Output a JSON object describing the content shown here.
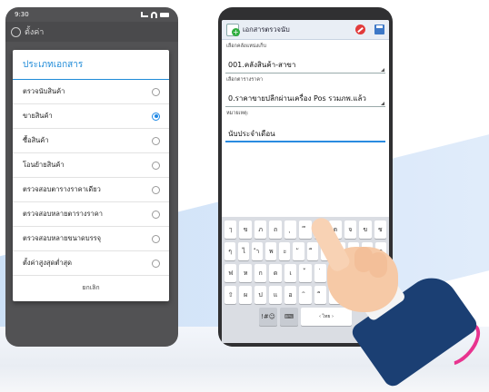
{
  "left_phone": {
    "status_time": "9:30",
    "appbar_title": "ตั้งค่า",
    "dialog": {
      "title": "ประเภทเอกสาร",
      "options": [
        {
          "label": "ตรวจนับสินค้า",
          "selected": false
        },
        {
          "label": "ขายสินค้า",
          "selected": true
        },
        {
          "label": "ซื้อสินค้า",
          "selected": false
        },
        {
          "label": "โอนย้ายสินค้า",
          "selected": false
        },
        {
          "label": "ตรวจสอบตารางราคาเดียว",
          "selected": false
        },
        {
          "label": "ตรวจสอบหลายตารางราคา",
          "selected": false
        },
        {
          "label": "ตรวจสอบหลายขนาดบรรจุ",
          "selected": false
        },
        {
          "label": "ตั้งค่าสูงสุดต่ำสุด",
          "selected": false
        }
      ],
      "cancel_label": "ยกเลิก"
    }
  },
  "right_phone": {
    "appbar_title": "เอกสารตรวจนับ",
    "warehouse_label": "เลือกคลังแหน่งเก็บ",
    "warehouse_value": "001.คลังสินค้า-สาขา",
    "price_table_label": "เลือกตารางราคา",
    "price_table_value": "0.ราคาขายปลีกผ่านเครื่อง Pos รวมภพ.แล้ว",
    "note_label": "หมายเหตุ:",
    "note_value": "นับประจำเดือน",
    "keyboard": {
      "row1": [
        "ๅ",
        "ข",
        "ภ",
        "ถ",
        "ุ",
        "ึ",
        "ค",
        "ต",
        "จ",
        "ข",
        "ช"
      ],
      "row2": [
        "ๆ",
        "ไ",
        "ำ",
        "พ",
        "ะ",
        "ั",
        "ี",
        "ร",
        "น",
        "ย",
        "บ",
        "ล"
      ],
      "row3": [
        "ฟ",
        "ห",
        "ก",
        "ด",
        "เ",
        "้",
        "่",
        "า",
        "ส",
        "ว",
        "ง"
      ],
      "row4": [
        "⇧",
        "ผ",
        "ป",
        "แ",
        "อ",
        "ิ",
        "ื",
        "ท",
        "ม",
        "ใ",
        "ฝ"
      ],
      "sym_key": "!#☺",
      "space_label": "‹ ไทย ›"
    }
  },
  "colors": {
    "accent": "#1f8bd8",
    "radio_on": "#1e88e5",
    "sleeve": "#1b3f73",
    "arc": "#e8338f"
  }
}
